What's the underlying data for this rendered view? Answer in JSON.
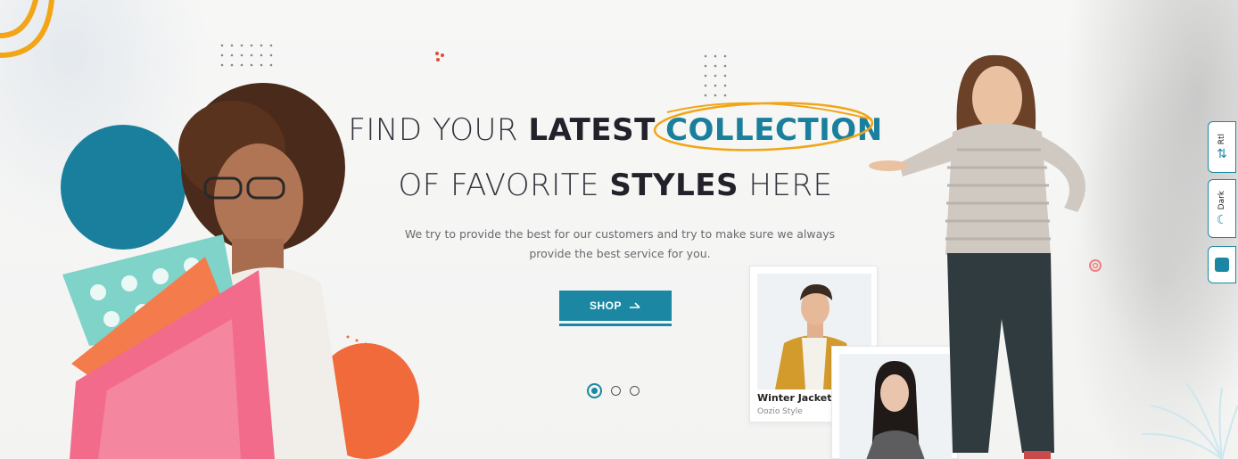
{
  "hero": {
    "headline_line1": {
      "light": "FIND YOUR",
      "bold": "LATEST",
      "highlight": "COLLECTION"
    },
    "headline_line2": {
      "light1": "OF FAVORITE",
      "bold": "STYLES",
      "light2": "HERE"
    },
    "subtext_line1": "We try to provide the best for our customers and try to make sure we always",
    "subtext_line2": "provide the best service for you.",
    "shop_label": "SHOP",
    "slides_total": 3,
    "slide_active": 1
  },
  "product_cards": [
    {
      "name": "Winter Jacket",
      "brand": "Oozio Style"
    }
  ],
  "side_controls": [
    {
      "label": "Rtl",
      "icon": "swap-icon"
    },
    {
      "label": "Dark",
      "icon": "moon-icon"
    },
    {
      "label": "",
      "icon": "color-swatch-icon"
    }
  ],
  "colors": {
    "accent": "#1b87a3",
    "highlight_ring": "#f2a516",
    "circle_blue": "#1a7f9c",
    "circle_orange": "#f06a3b",
    "bag_pink": "#f26b8a"
  }
}
